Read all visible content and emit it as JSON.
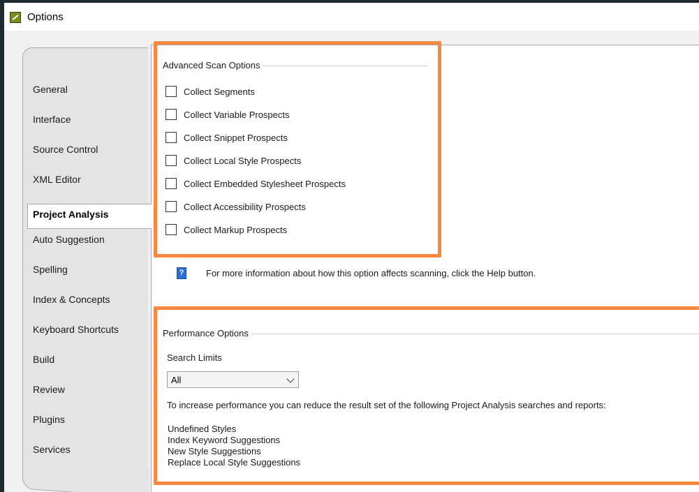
{
  "window": {
    "title": "Options",
    "accent_color": "#f6893f"
  },
  "sidebar": {
    "active_index": 4,
    "items": [
      {
        "label": "General"
      },
      {
        "label": "Interface"
      },
      {
        "label": "Source Control"
      },
      {
        "label": "XML Editor"
      },
      {
        "label": "Project Analysis"
      },
      {
        "label": "Auto Suggestion"
      },
      {
        "label": "Spelling"
      },
      {
        "label": "Index & Concepts"
      },
      {
        "label": "Keyboard Shortcuts"
      },
      {
        "label": "Build"
      },
      {
        "label": "Review"
      },
      {
        "label": "Plugins"
      },
      {
        "label": "Services"
      }
    ]
  },
  "advanced_scan": {
    "title": "Advanced Scan Options",
    "options": [
      {
        "label": "Collect Segments",
        "checked": false
      },
      {
        "label": "Collect Variable Prospects",
        "checked": false
      },
      {
        "label": "Collect Snippet Prospects",
        "checked": false
      },
      {
        "label": "Collect Local Style Prospects",
        "checked": false
      },
      {
        "label": "Collect Embedded Stylesheet Prospects",
        "checked": false
      },
      {
        "label": "Collect Accessibility Prospects",
        "checked": false
      },
      {
        "label": "Collect Markup Prospects",
        "checked": false
      }
    ]
  },
  "info": {
    "text": "For more information about how this option affects scanning, click the Help button."
  },
  "performance": {
    "title": "Performance Options",
    "search_limits_label": "Search Limits",
    "search_limits_value": "All",
    "description": "To increase performance you can reduce the result set of the following Project Analysis searches and reports:",
    "items": [
      "Undefined Styles",
      "Index Keyword Suggestions",
      "New Style Suggestions",
      "Replace Local Style Suggestions"
    ]
  }
}
